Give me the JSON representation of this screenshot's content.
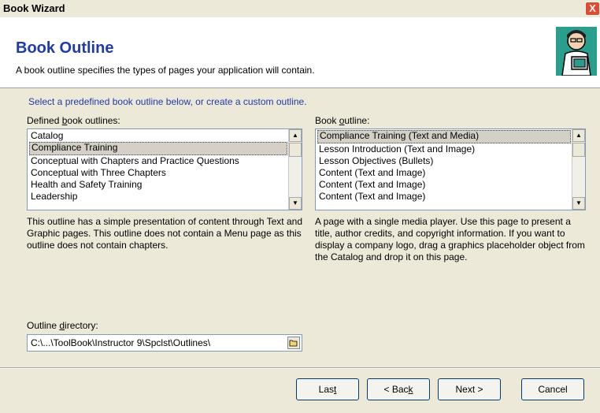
{
  "window": {
    "title": "Book Wizard",
    "close_symbol": "X"
  },
  "header": {
    "title": "Book Outline",
    "subtitle": "A book outline specifies the types of pages your application will contain."
  },
  "instruction": "Select a predefined book outline below, or create a custom outline.",
  "defined_outlines": {
    "label_pre": "Defined ",
    "label_ul": "b",
    "label_post": "ook outlines:",
    "items": [
      "Catalog",
      "Compliance Training",
      "Conceptual with Chapters and Practice Questions",
      "Conceptual with Three Chapters",
      "Health and Safety Training",
      "Leadership"
    ],
    "selected_index": 1,
    "description": "This outline has a simple presentation of content through Text and Graphic pages.  This outline does not contain a Menu page as this outline does not contain chapters."
  },
  "book_outline": {
    "label_pre": "Book ",
    "label_ul": "o",
    "label_post": "utline:",
    "items": [
      "Compliance Training (Text and Media)",
      "Lesson Introduction (Text and Image)",
      "Lesson Objectives (Bullets)",
      "Content (Text and Image)",
      "Content (Text and Image)",
      "Content (Text and Image)"
    ],
    "selected_index": 0,
    "description": "A page with a single media player. Use this page to present a title, author credits, and copyright information. If you want to display a company logo, drag a graphics placeholder object from the Catalog and drop it on this page."
  },
  "directory": {
    "label_pre": "Outline ",
    "label_ul": "d",
    "label_post": "irectory:",
    "value": "C:\\...\\ToolBook\\Instructor 9\\Spclst\\Outlines\\"
  },
  "buttons": {
    "last_pre": "Las",
    "last_ul": "t",
    "last_post": "",
    "back_pre": "< Bac",
    "back_ul": "k",
    "back_post": "",
    "next": "Next >",
    "cancel": "Cancel"
  },
  "colors": {
    "accent": "#1f3ba8",
    "close": "#e24b2e",
    "face": "#ece9d8"
  }
}
